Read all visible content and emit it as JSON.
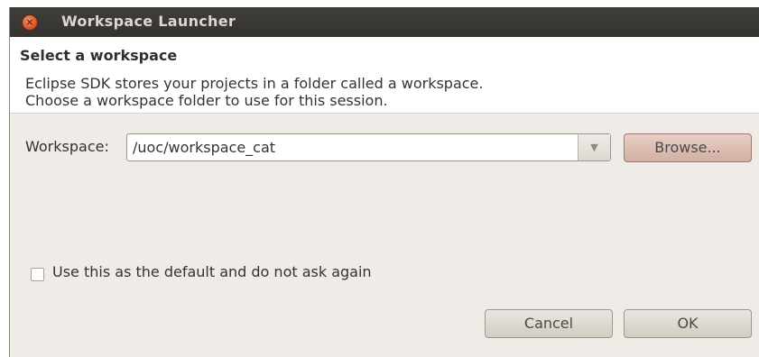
{
  "window": {
    "title": "Workspace Launcher",
    "close_glyph": "×"
  },
  "header": {
    "title": "Select a workspace",
    "desc_line1": "Eclipse SDK stores your projects in a folder called a workspace.",
    "desc_line2": "Choose a workspace folder to use for this session."
  },
  "workspace": {
    "label": "Workspace:",
    "value": "/uoc/workspace_cat",
    "dropdown_glyph": "▼",
    "browse_label": "Browse..."
  },
  "default_checkbox": {
    "label": "Use this as the default and do not ask again",
    "checked": false
  },
  "buttons": {
    "cancel": "Cancel",
    "ok": "OK"
  },
  "colors": {
    "titlebar": "#3c3b37",
    "dialog_bg": "#efebe7",
    "close_button": "#e0552c",
    "browse_accent": "#d8b8ad"
  }
}
